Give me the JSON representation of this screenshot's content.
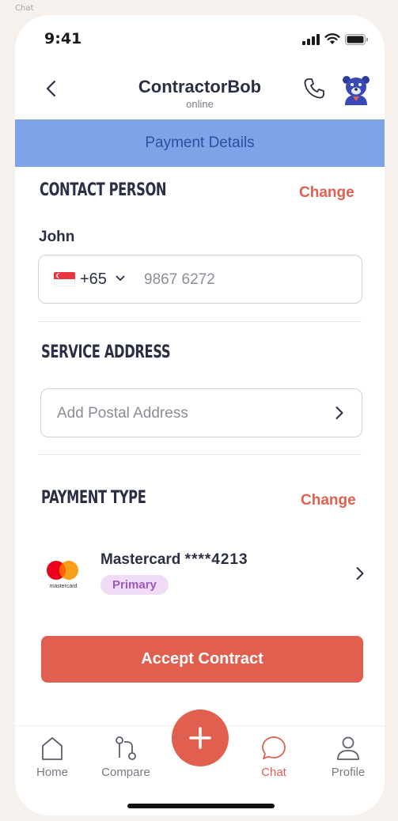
{
  "canvas_label": "Chat",
  "status_bar": {
    "time": "9:41"
  },
  "header": {
    "title": "ContractorBob",
    "subtitle": "online"
  },
  "banner": {
    "label": "Payment Details"
  },
  "contact": {
    "section_title": "CONTACT PERSON",
    "change_label": "Change",
    "name": "John",
    "country_code": "+65",
    "phone_number": "9867 6272"
  },
  "service_address": {
    "section_title": "SERVICE ADDRESS",
    "placeholder": "Add Postal Address"
  },
  "payment_type": {
    "section_title": "PAYMENT TYPE",
    "change_label": "Change",
    "card_brand": "Mastercard",
    "card_number": "****4213",
    "badge": "Primary",
    "logo_text": "mastercard"
  },
  "actions": {
    "accept_label": "Accept Contract"
  },
  "tabbar": {
    "items": [
      {
        "label": "Home",
        "icon": "home-icon",
        "active": false
      },
      {
        "label": "Compare",
        "icon": "compare-icon",
        "active": false
      },
      {
        "label": "Chat",
        "icon": "chat-icon",
        "active": true
      },
      {
        "label": "Profile",
        "icon": "profile-icon",
        "active": false
      }
    ],
    "fab_icon": "plus-icon"
  },
  "colors": {
    "accent": "#e05f4f",
    "banner_bg": "#7fa3e8",
    "banner_text": "#2c4f9e",
    "badge_bg": "#f0dcf7",
    "badge_text": "#9a59bd"
  }
}
